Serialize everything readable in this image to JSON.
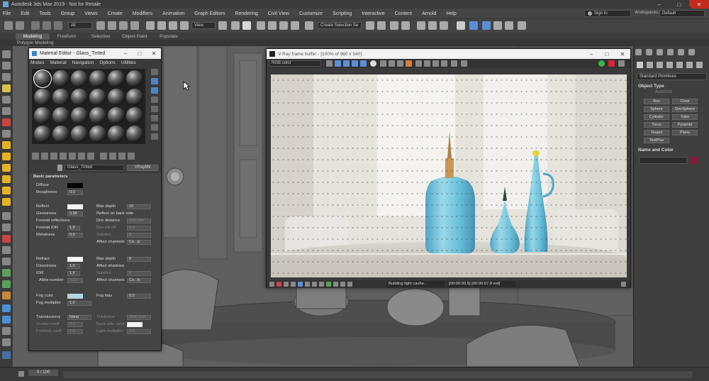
{
  "titlebar": {
    "title": "Autodesk 3ds Max 2019 - Not for Resale"
  },
  "menubar": {
    "items": [
      "File",
      "Edit",
      "Tools",
      "Group",
      "Views",
      "Create",
      "Modifiers",
      "Animation",
      "Graph Editors",
      "Rendering",
      "Civil View",
      "Customize",
      "Scripting",
      "Interactive",
      "Content",
      "Arnold",
      "Help"
    ],
    "signin": "Sign In",
    "workspaces_label": "Workspaces:",
    "workspaces_value": "Default"
  },
  "toolbar": {
    "filter_select": "All",
    "view_select": "View",
    "selection_set": "Create Selection Se"
  },
  "ribbon": {
    "tabs": [
      "Modeling",
      "Freeform",
      "Selection",
      "Object Paint",
      "Populate"
    ],
    "sub_label": "Polygon Modeling"
  },
  "material_editor": {
    "title": "Material Editor - Glass_Tinted",
    "menu": [
      "Modes",
      "Material",
      "Navigation",
      "Options",
      "Utilities"
    ],
    "material_name": "Glass_Tinted",
    "material_type": "VRayMtl",
    "section_title": "Basic parameters",
    "diffuse_label": "Diffuse",
    "roughness_label": "Roughness",
    "roughness_value": "0,0",
    "reflect_label": "Reflect",
    "max_depth_label": "Max depth",
    "max_depth_value": "10",
    "glossiness_label": "Glossiness",
    "glossiness_value": "0,98",
    "reflect_backside_label": "Reflect on back side",
    "fresnel_label": "Fresnel reflections",
    "dim_distance_label": "Dim distance",
    "dim_distance_value": "100,0cm",
    "fresnel_ior_label": "Fresnel IOR",
    "fresnel_ior_value": "1,6",
    "dim_falloff_label": "Dim fall off",
    "dim_falloff_value": "0,0",
    "subdivs_label": "Subdivs",
    "subdivs_value": "8",
    "metalness_label": "Metalness",
    "metalness_value": "0,0",
    "affect_channels_label": "Affect channels",
    "affect_channels_value": "Co...ly",
    "refract_label": "Refract",
    "refract_max_depth_value": "8",
    "refract_glossiness_value": "1,0",
    "affect_shadows_label": "Affect shadows",
    "ior_label": "IOR",
    "ior_value": "1,6",
    "refract_subdivs_value": "8",
    "abbe_label": "Abbe number",
    "abbe_value": "50,0",
    "refract_affect_channels_value": "Co...ly",
    "fog_color_label": "Fog color",
    "fog_bias_label": "Fog bias",
    "fog_bias_value": "0,0",
    "fog_multiplier_label": "Fog multiplier",
    "fog_multiplier_value": "1,0",
    "translucency_label": "Translucency",
    "translucency_value": "None",
    "thickness_label": "Thickness",
    "thickness_value": "1000,0cm",
    "scatter_coeff_label": "Scatter coeff",
    "scatter_coeff_value": "0,0",
    "back_side_color_label": "Back-side color",
    "fwd_bck_coeff_label": "Fwd/bck coeff",
    "fwd_bck_coeff_value": "1,0",
    "light_multiplier_label": "Light multiplier",
    "light_multiplier_value": "1,0"
  },
  "frame_buffer": {
    "title": "V-Ray frame buffer - [100% of 960 x 540]",
    "channel": "RGB color",
    "status": "Building light cache...",
    "time": "[00:00:00.5] [00:00:07.8 est]"
  },
  "command_panel": {
    "category": "Standard Primitives",
    "object_type_title": "Object Type",
    "autogrid": "AutoGrid",
    "objects": [
      "Box",
      "Cone",
      "Sphere",
      "GeoSphere",
      "Cylinder",
      "Tube",
      "Torus",
      "Pyramid",
      "Teapot",
      "Plane",
      "TextPlus"
    ],
    "name_color_title": "Name and Color"
  },
  "timeline": {
    "frame": "0 / 100"
  },
  "colors": {
    "accent_blue": "#5b8ed8",
    "render_glass": "#4fb3d3",
    "selection_color": "#8b1a3a"
  }
}
